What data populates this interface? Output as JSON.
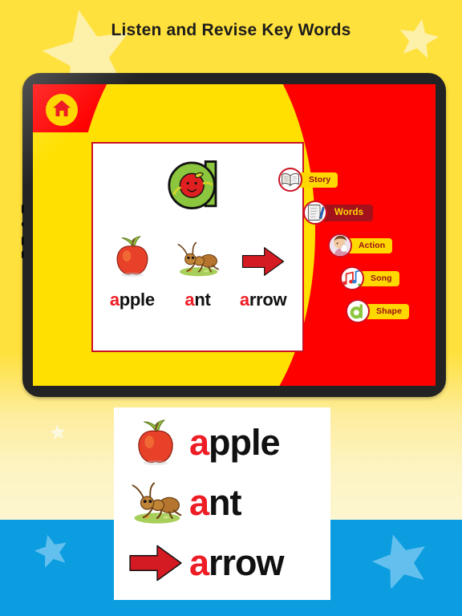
{
  "page": {
    "title": "Listen and Revise Key Words",
    "background_color": "#ffe13d",
    "bottom_band_color": "#0b9de0"
  },
  "tablet": {
    "home_button": {
      "icon": "home-icon",
      "label": "Home"
    },
    "screen": {
      "letter": "a",
      "letter_color": "#8cc63e",
      "card": {
        "words": [
          {
            "text": "apple",
            "first_letter": "a",
            "rest": "pple",
            "image": "apple-image"
          },
          {
            "text": "ant",
            "first_letter": "a",
            "rest": "nt",
            "image": "ant-image"
          },
          {
            "text": "arrow",
            "first_letter": "a",
            "rest": "rrow",
            "image": "arrow-image"
          }
        ]
      },
      "menu": {
        "items": [
          {
            "label": "Story",
            "icon": "open-book-icon",
            "active": false
          },
          {
            "label": "Words",
            "icon": "notepad-pen-icon",
            "active": true
          },
          {
            "label": "Action",
            "icon": "child-action-icon",
            "active": false
          },
          {
            "label": "Song",
            "icon": "music-notes-icon",
            "active": false
          },
          {
            "label": "Shape",
            "icon": "letter-a-icon",
            "active": false
          }
        ],
        "active_pill_color": "#a3111b",
        "pill_color": "#ffd800"
      }
    }
  },
  "bottom_card": {
    "rows": [
      {
        "text": "apple",
        "first_letter": "a",
        "rest": "pple",
        "image": "apple-image"
      },
      {
        "text": "ant",
        "first_letter": "a",
        "rest": "nt",
        "image": "ant-image"
      },
      {
        "text": "arrow",
        "first_letter": "a",
        "rest": "rrow",
        "image": "arrow-image"
      }
    ],
    "accent_color": "#ee1c25"
  },
  "decor": {
    "star_top_left": "star-icon",
    "star_top_right": "star-icon",
    "star_mid_left": "star-icon",
    "star_bottom_left": "star-icon",
    "star_bottom_right": "star-icon"
  }
}
